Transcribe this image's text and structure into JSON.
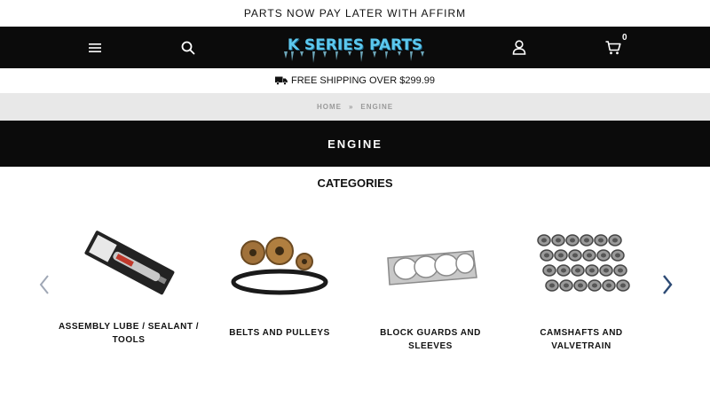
{
  "announcement": "PARTS NOW PAY LATER WITH AFFIRM",
  "header": {
    "logo_text": "K SERIES PARTS",
    "cart_count": "0"
  },
  "shipping": {
    "text": "FREE SHIPPING OVER $299.99",
    "icon": "truck-icon"
  },
  "breadcrumb": {
    "home": "HOME",
    "separator": "»",
    "current": "ENGINE"
  },
  "banner": {
    "title": "ENGINE"
  },
  "categories": {
    "heading": "CATEGORIES",
    "items": [
      {
        "label": "ASSEMBLY LUBE / SEALANT / TOOLS"
      },
      {
        "label": "BELTS AND PULLEYS"
      },
      {
        "label": "BLOCK GUARDS AND SLEEVES"
      },
      {
        "label": "CAMSHAFTS AND VALVETRAIN"
      }
    ]
  },
  "colors": {
    "header_bg": "#0b0b0b",
    "breadcrumb_bg": "#e8e8e8",
    "logo_blue": "#5cc8ee",
    "arrow_left": "#9fa7b5",
    "arrow_right": "#2c4a74"
  }
}
